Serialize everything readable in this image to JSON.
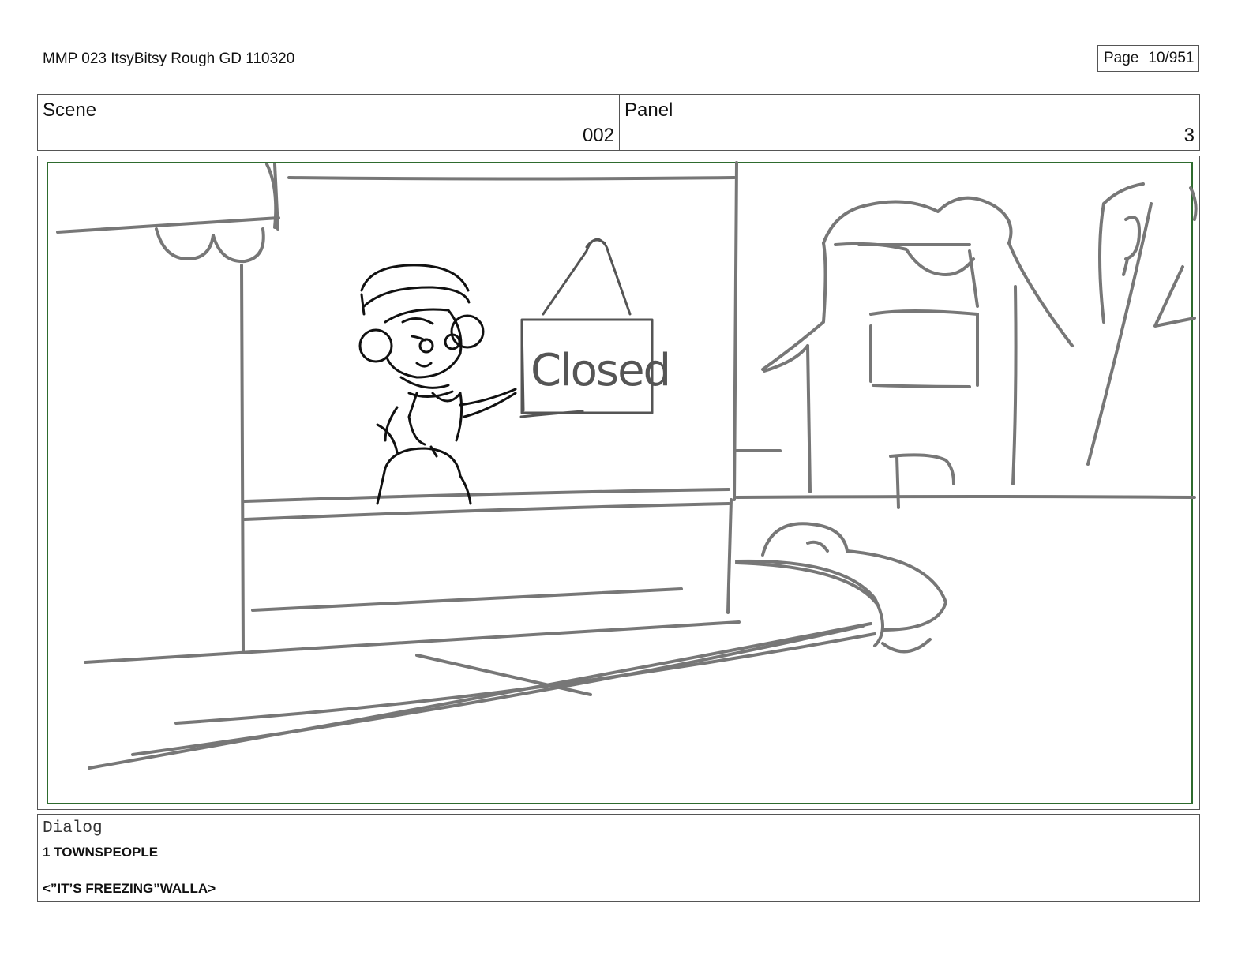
{
  "document": {
    "title": "MMP 023 ItsyBitsy Rough GD 110320",
    "page_label": "Page",
    "page_number": "10/951"
  },
  "header": {
    "scene_label": "Scene",
    "scene_value": "002",
    "panel_label": "Panel",
    "panel_value": "3"
  },
  "drawing": {
    "sign_text": "Closed",
    "frame_color": "#2e6b2e",
    "sketch_color": "#777777",
    "character_color": "#111111"
  },
  "dialog": {
    "label": "Dialog",
    "speaker": "1 TOWNSPEOPLE",
    "line": "<”IT’S FREEZING”WALLA>"
  }
}
